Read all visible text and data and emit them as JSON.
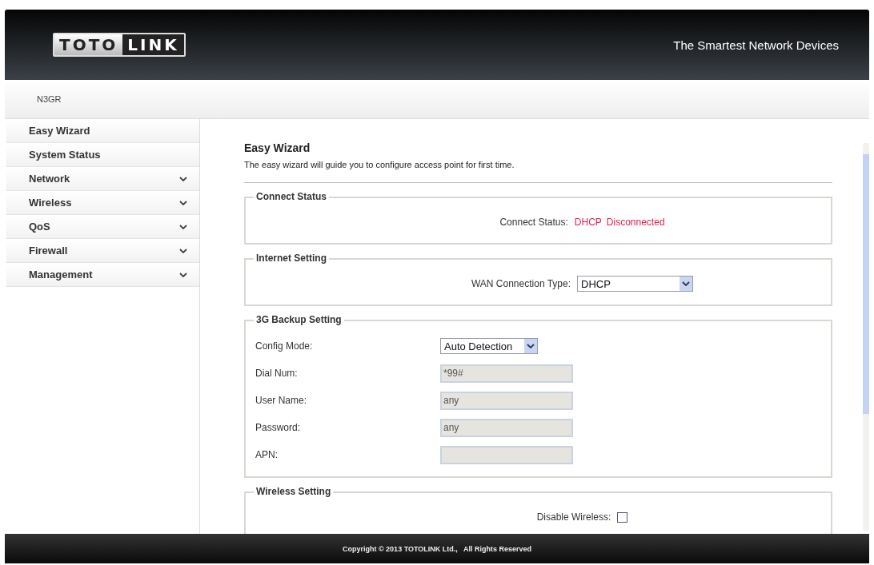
{
  "header": {
    "logo_left": "TOTO",
    "logo_right": "LINK",
    "tagline": "The Smartest Network Devices"
  },
  "model": "N3GR",
  "sidebar": {
    "items": [
      {
        "label": "Easy Wizard",
        "expandable": false
      },
      {
        "label": "System Status",
        "expandable": false
      },
      {
        "label": "Network",
        "expandable": true
      },
      {
        "label": "Wireless",
        "expandable": true
      },
      {
        "label": "QoS",
        "expandable": true
      },
      {
        "label": "Firewall",
        "expandable": true
      },
      {
        "label": "Management",
        "expandable": true
      }
    ]
  },
  "content": {
    "title": "Easy Wizard",
    "description": "The easy wizard will guide you to configure access point for first time.",
    "sections": [
      {
        "legend": "Connect Status",
        "kind": "centered",
        "rows": [
          {
            "kind": "status",
            "label": "Connect Status:",
            "values": [
              "DHCP",
              "Disconnected"
            ]
          }
        ]
      },
      {
        "legend": "Internet Setting",
        "kind": "centered",
        "rows": [
          {
            "kind": "select",
            "label": "WAN Connection Type:",
            "value": "DHCP"
          }
        ]
      },
      {
        "legend": "3G Backup Setting",
        "kind": "form",
        "rows": [
          {
            "kind": "select",
            "label": "Config Mode:",
            "value": "Auto Detection"
          },
          {
            "kind": "input",
            "label": "Dial Num:",
            "value": "*99#",
            "disabled": true
          },
          {
            "kind": "input",
            "label": "User Name:",
            "value": "any",
            "disabled": true
          },
          {
            "kind": "input",
            "label": "Password:",
            "value": "any",
            "disabled": true
          },
          {
            "kind": "input",
            "label": "APN:",
            "disabled": true
          }
        ]
      },
      {
        "legend": "Wireless Setting",
        "kind": "centered",
        "rows": [
          {
            "kind": "checkbox",
            "label": "Disable Wireless:",
            "checked": false
          }
        ]
      }
    ]
  },
  "footer": "Copyright © 2013 TOTOLINK Ltd.,   All Rights Reserved"
}
